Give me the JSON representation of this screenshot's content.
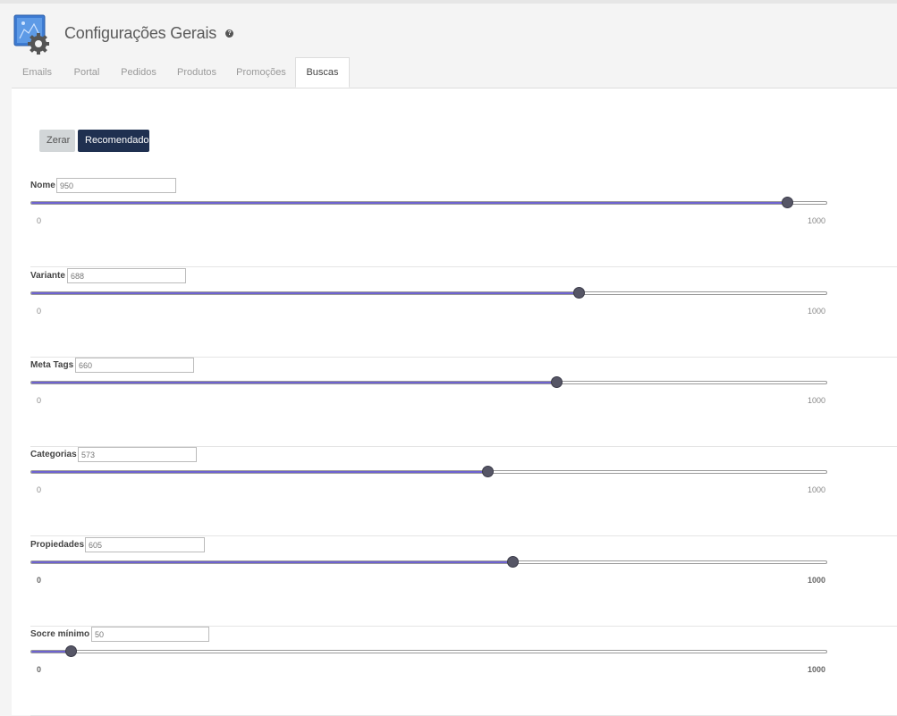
{
  "page": {
    "title": "Configurações Gerais",
    "help_icon": "question-circle-icon",
    "app_icon": "settings-gear-icon"
  },
  "tabs": [
    {
      "label": "Emails",
      "active": false
    },
    {
      "label": "Portal",
      "active": false
    },
    {
      "label": "Pedidos",
      "active": false
    },
    {
      "label": "Produtos",
      "active": false
    },
    {
      "label": "Promoções",
      "active": false
    },
    {
      "label": "Buscas",
      "active": true
    }
  ],
  "actions": {
    "reset_label": "Zerar",
    "recommended_label": "Recomendado"
  },
  "sliders": [
    {
      "label": "Nome",
      "value": "950",
      "min": "0",
      "max": "1000"
    },
    {
      "label": "Variante",
      "value": "688",
      "min": "0",
      "max": "1000"
    },
    {
      "label": "Meta Tags",
      "value": "660",
      "min": "0",
      "max": "1000"
    },
    {
      "label": "Categorias",
      "value": "573",
      "min": "0",
      "max": "1000"
    },
    {
      "label": "Propiedades",
      "value": "605",
      "min": "0",
      "max": "1000"
    },
    {
      "label": "Socre mínimo",
      "value": "50",
      "min": "0",
      "max": "1000"
    }
  ],
  "colors": {
    "accent_fill": "#6e63d0",
    "primary_button": "#1f3050",
    "secondary_button": "#d2d6d8",
    "thumb": "#565666"
  }
}
